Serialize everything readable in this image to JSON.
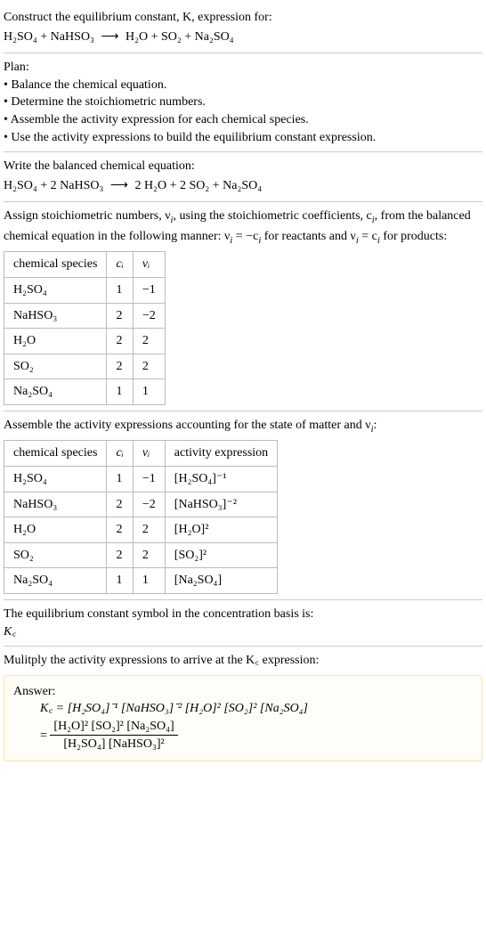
{
  "intro": {
    "line1": "Construct the equilibrium constant, K, expression for:",
    "eq_lhs": "H₂SO₄ + NaHSO₃",
    "eq_arrow": "⟶",
    "eq_rhs": "H₂O + SO₂ + Na₂SO₄"
  },
  "plan": {
    "title": "Plan:",
    "items": [
      "• Balance the chemical equation.",
      "• Determine the stoichiometric numbers.",
      "• Assemble the activity expression for each chemical species.",
      "• Use the activity expressions to build the equilibrium constant expression."
    ]
  },
  "balanced": {
    "title": "Write the balanced chemical equation:",
    "eq_lhs": "H₂SO₄ + 2 NaHSO₃",
    "eq_arrow": "⟶",
    "eq_rhs": "2 H₂O + 2 SO₂ + Na₂SO₄"
  },
  "stoich": {
    "intro_a": "Assign stoichiometric numbers, ν",
    "intro_b": ", using the stoichiometric coefficients, c",
    "intro_c": ", from the balanced chemical equation in the following manner: ν",
    "intro_d": " = −c",
    "intro_e": " for reactants and ν",
    "intro_f": " = c",
    "intro_g": " for products:",
    "headers": {
      "species": "chemical species",
      "ci": "cᵢ",
      "vi": "νᵢ"
    },
    "rows": [
      {
        "species": "H₂SO₄",
        "ci": "1",
        "vi": "−1"
      },
      {
        "species": "NaHSO₃",
        "ci": "2",
        "vi": "−2"
      },
      {
        "species": "H₂O",
        "ci": "2",
        "vi": "2"
      },
      {
        "species": "SO₂",
        "ci": "2",
        "vi": "2"
      },
      {
        "species": "Na₂SO₄",
        "ci": "1",
        "vi": "1"
      }
    ]
  },
  "activity": {
    "intro_a": "Assemble the activity expressions accounting for the state of matter and ν",
    "intro_b": ":",
    "headers": {
      "species": "chemical species",
      "ci": "cᵢ",
      "vi": "νᵢ",
      "expr": "activity expression"
    },
    "rows": [
      {
        "species": "H₂SO₄",
        "ci": "1",
        "vi": "−1",
        "expr": "[H₂SO₄]⁻¹"
      },
      {
        "species": "NaHSO₃",
        "ci": "2",
        "vi": "−2",
        "expr": "[NaHSO₃]⁻²"
      },
      {
        "species": "H₂O",
        "ci": "2",
        "vi": "2",
        "expr": "[H₂O]²"
      },
      {
        "species": "SO₂",
        "ci": "2",
        "vi": "2",
        "expr": "[SO₂]²"
      },
      {
        "species": "Na₂SO₄",
        "ci": "1",
        "vi": "1",
        "expr": "[Na₂SO₄]"
      }
    ]
  },
  "symbol": {
    "line1": "The equilibrium constant symbol in the concentration basis is:",
    "kc": "K꜀"
  },
  "final": {
    "title": "Mulitply the activity expressions to arrive at the K꜀ expression:",
    "answer_label": "Answer:",
    "line1": "K꜀ = [H₂SO₄]⁻¹ [NaHSO₃]⁻² [H₂O]² [SO₂]² [Na₂SO₄]",
    "frac_num": "[H₂O]² [SO₂]² [Na₂SO₄]",
    "frac_den": "[H₂SO₄] [NaHSO₃]²",
    "equals": "= "
  }
}
